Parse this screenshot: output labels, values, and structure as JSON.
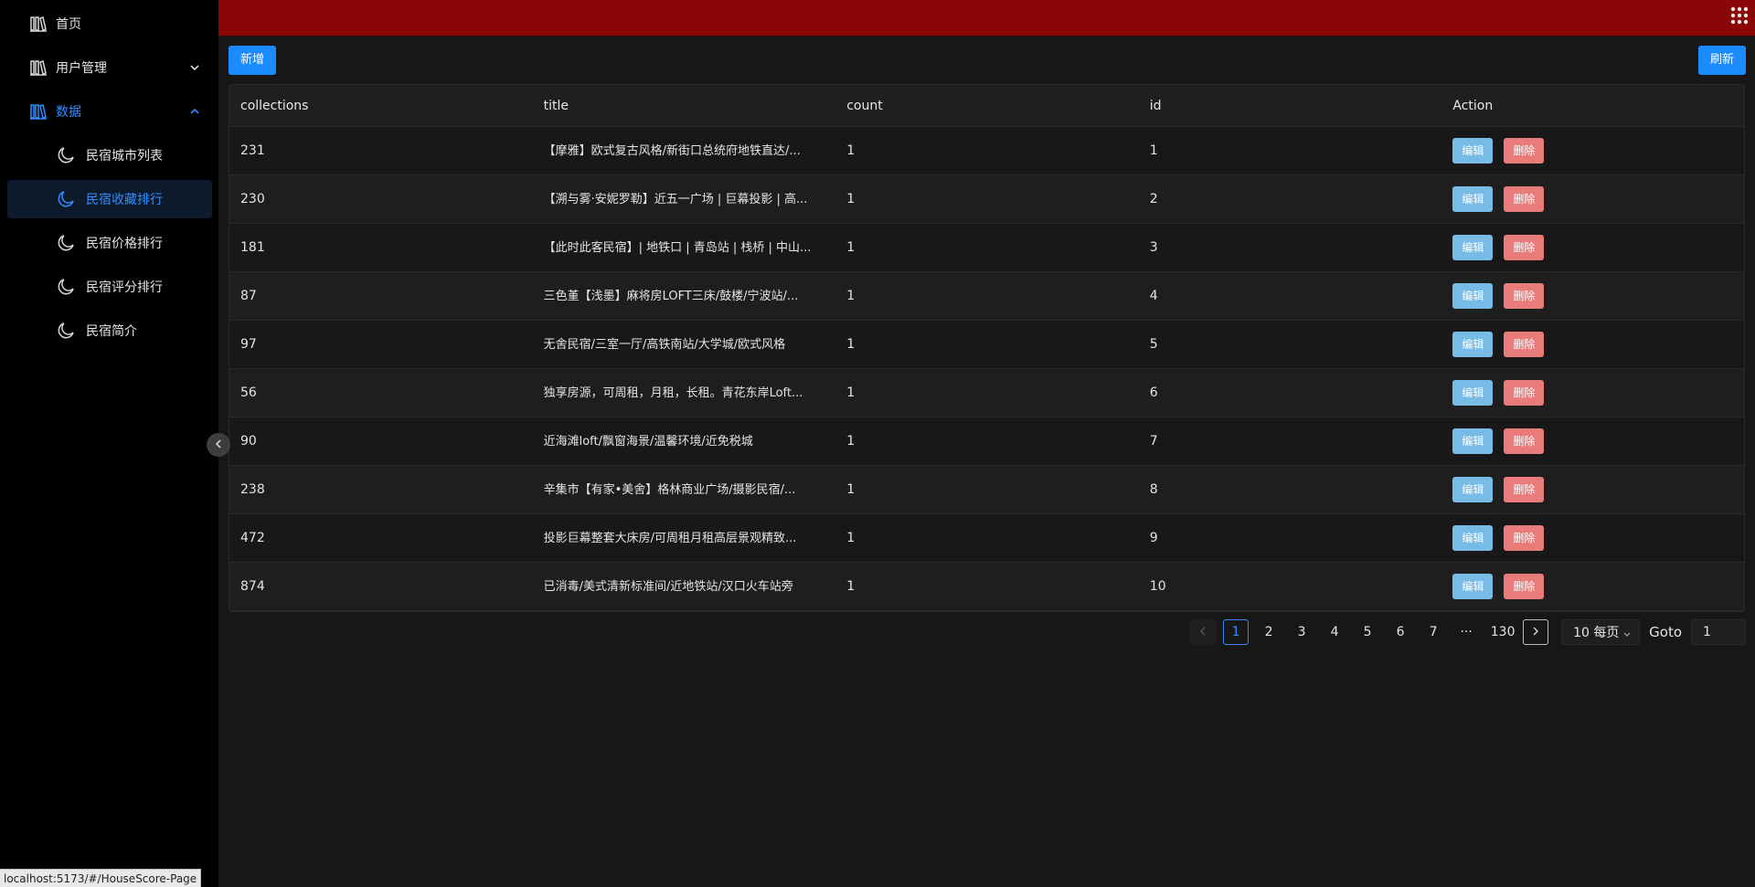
{
  "sidebar": {
    "items": [
      {
        "label": "首页",
        "icon": "library-icon"
      },
      {
        "label": "用户管理",
        "icon": "library-icon"
      },
      {
        "label": "数据",
        "icon": "library-icon"
      }
    ],
    "sub_items": [
      {
        "label": "民宿城市列表",
        "icon": "moon-icon"
      },
      {
        "label": "民宿收藏排行",
        "icon": "moon-icon"
      },
      {
        "label": "民宿价格排行",
        "icon": "moon-icon"
      },
      {
        "label": "民宿评分排行",
        "icon": "moon-icon"
      },
      {
        "label": "民宿简介",
        "icon": "moon-icon"
      }
    ]
  },
  "toolbar": {
    "add_label": "新增",
    "refresh_label": "刷新"
  },
  "table": {
    "headers": [
      "collections",
      "title",
      "count",
      "id",
      "Action"
    ],
    "edit_label": "编辑",
    "delete_label": "删除",
    "rows": [
      {
        "collections": "231",
        "title": "【摩雅】欧式复古风格/新街口总统府地铁直达/...",
        "count": "1",
        "id": "1"
      },
      {
        "collections": "230",
        "title": "【溯与雾·安妮罗勒】近五一广场 | 巨幕投影 | 高...",
        "count": "1",
        "id": "2"
      },
      {
        "collections": "181",
        "title": "【此时此客民宿】| 地铁口 | 青岛站 | 栈桥 | 中山...",
        "count": "1",
        "id": "3"
      },
      {
        "collections": "87",
        "title": "三色堇【浅墨】麻将房LOFT三床/鼓楼/宁波站/...",
        "count": "1",
        "id": "4"
      },
      {
        "collections": "97",
        "title": "无舍民宿/三室一厅/高铁南站/大学城/欧式风格",
        "count": "1",
        "id": "5"
      },
      {
        "collections": "56",
        "title": "独享房源，可周租，月租，长租。青花东岸Loft...",
        "count": "1",
        "id": "6"
      },
      {
        "collections": "90",
        "title": "近海滩loft/飘窗海景/温馨环境/近免税城",
        "count": "1",
        "id": "7"
      },
      {
        "collections": "238",
        "title": "辛集市【有家•美舍】格林商业广场/摄影民宿/...",
        "count": "1",
        "id": "8"
      },
      {
        "collections": "472",
        "title": "投影巨幕整套大床房/可周租月租高层景观精致...",
        "count": "1",
        "id": "9"
      },
      {
        "collections": "874",
        "title": "已消毒/美式清新标准间/近地铁站/汉口火车站旁",
        "count": "1",
        "id": "10"
      }
    ]
  },
  "pagination": {
    "pages": [
      "1",
      "2",
      "3",
      "4",
      "5",
      "6",
      "7",
      "···",
      "130"
    ],
    "current": "1",
    "page_size": "10 每页",
    "goto_label": "Goto",
    "goto_value": "1"
  },
  "status_url": "localhost:5173/#/HouseScore-Page",
  "colors": {
    "header": "#8b0707",
    "primary": "#1b8cff",
    "edit": "#79bbe7",
    "delete": "#ea7b7b",
    "active_menu": "#2f8fff"
  }
}
